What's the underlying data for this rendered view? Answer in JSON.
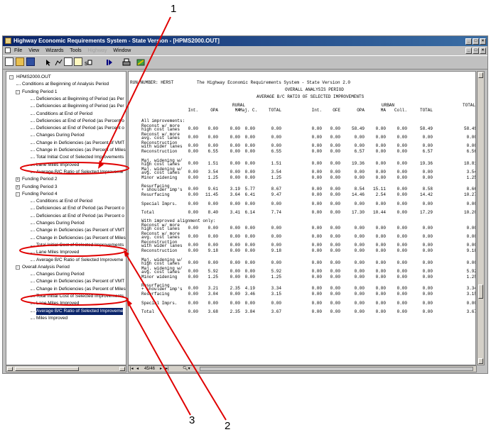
{
  "window": {
    "title": "Highway Economic Requirements System - State Version - [HPMS2000.OUT]",
    "menu": [
      "File",
      "View",
      "Wizards",
      "Tools",
      "Highway",
      "Window"
    ],
    "page_indicator": "45/46"
  },
  "tree": {
    "root": "HPMS2000.OUT",
    "items": [
      {
        "label": "Conditions at Beginning of Analysis Period",
        "level": 1,
        "pm": ""
      },
      {
        "label": "Funding Period 1",
        "level": 1,
        "pm": "-"
      },
      {
        "label": "Deficiencies at Beginning of Period (as Per",
        "level": 2,
        "pm": ""
      },
      {
        "label": "Deficiencies at Beginning of Period (as Per",
        "level": 2,
        "pm": ""
      },
      {
        "label": "Conditions at End of Period",
        "level": 2,
        "pm": ""
      },
      {
        "label": "Deficiencies at End of Period (as Percent o",
        "level": 2,
        "pm": ""
      },
      {
        "label": "Deficiencies at End of Period (as Percent o",
        "level": 2,
        "pm": ""
      },
      {
        "label": "Changes During Period",
        "level": 2,
        "pm": ""
      },
      {
        "label": "Change in Deficiencies (as Percent of VMT",
        "level": 2,
        "pm": ""
      },
      {
        "label": "Change in Deficiencies (as Percent of Miles",
        "level": 2,
        "pm": ""
      },
      {
        "label": "Total Initial Cost of Selected Improvements",
        "level": 2,
        "pm": ""
      },
      {
        "label": "Lane Miles Improved",
        "level": 2,
        "pm": ""
      },
      {
        "label": "Average B/C Ratio of Selected Improveme",
        "level": 2,
        "pm": ""
      },
      {
        "label": "Funding Period 2",
        "level": 1,
        "pm": "+"
      },
      {
        "label": "Funding Period 3",
        "level": 1,
        "pm": "+"
      },
      {
        "label": "Funding Period 4",
        "level": 1,
        "pm": "-"
      },
      {
        "label": "Conditions at End of Period",
        "level": 2,
        "pm": ""
      },
      {
        "label": "Deficiencies at End of Period (as Percent o",
        "level": 2,
        "pm": ""
      },
      {
        "label": "Deficiencies at End of Period (as Percent o",
        "level": 2,
        "pm": ""
      },
      {
        "label": "Changes During Period",
        "level": 2,
        "pm": ""
      },
      {
        "label": "Change in Deficiencies (as Percent of VMT",
        "level": 2,
        "pm": ""
      },
      {
        "label": "Change in Deficiencies (as Percent of Miles",
        "level": 2,
        "pm": ""
      },
      {
        "label": "Total Initial Cost of Selected Improvements",
        "level": 2,
        "pm": ""
      },
      {
        "label": "Lane Miles Improved",
        "level": 2,
        "pm": ""
      },
      {
        "label": "Average B/C Ratio of Selected Improveme",
        "level": 2,
        "pm": ""
      },
      {
        "label": "Overall Analysis Period",
        "level": 1,
        "pm": "-"
      },
      {
        "label": "Changes During Period",
        "level": 2,
        "pm": ""
      },
      {
        "label": "Change in Deficiencies (as Percent of VMT",
        "level": 2,
        "pm": ""
      },
      {
        "label": "Change in Deficiencies (as Percent of Miles",
        "level": 2,
        "pm": ""
      },
      {
        "label": "Total Initial Cost of Selected Improvements",
        "level": 2,
        "pm": ""
      },
      {
        "label": "Lane Miles Improved",
        "level": 2,
        "pm": ""
      },
      {
        "label": "Average B/C Ratio of Selected Improveme",
        "level": 2,
        "pm": "",
        "selected": true
      },
      {
        "label": "Miles Improved",
        "level": 2,
        "pm": ""
      }
    ]
  },
  "report": {
    "run_label": "RUN NUMBER: HERST",
    "system_title": "The Highway Economic Requirements System - State Version 2.0",
    "period_title": "OVERALL ANALYSIS PERIOD",
    "table_title": "AVERAGE B/C RATIO OF SELECTED IMPROVEMENTS",
    "rural_label": "RURAL",
    "urban_label": "URBAN",
    "total_label": "TOTAL",
    "col_headers": [
      "Int.",
      "OPA",
      "MA",
      "Maj. C.",
      "TOTAL",
      "Int.",
      "OFE",
      "OPA",
      "MA",
      "Coll.",
      "TOTAL"
    ],
    "section1": "All improvements:",
    "section2": "With improved alignment only:",
    "rows1": [
      {
        "label1": "Reconst w/ more",
        "label2": "high cost lanes",
        "vals": [
          "0.00",
          "0.00",
          "0.00",
          "0.00",
          "0.00",
          "0.00",
          "0.00",
          "58.49",
          "0.00",
          "0.00",
          "58.49",
          "58.49"
        ]
      },
      {
        "label1": "Reconst w/ more",
        "label2": "avg. cost lanes",
        "vals": [
          "0.00",
          "0.00",
          "0.00",
          "0.00",
          "0.00",
          "0.00",
          "0.00",
          "0.00",
          "0.00",
          "0.00",
          "0.00",
          "0.00"
        ]
      },
      {
        "label1": "Reconstruction",
        "label2": "with wider lanes",
        "vals": [
          "0.00",
          "0.00",
          "0.00",
          "0.00",
          "0.00",
          "0.00",
          "0.00",
          "0.00",
          "0.00",
          "0.00",
          "0.00",
          "0.00"
        ]
      },
      {
        "label1": "Reconstruction",
        "label2": "",
        "vals": [
          "0.00",
          "6.55",
          "0.00",
          "0.00",
          "6.55",
          "0.00",
          "0.00",
          "6.57",
          "0.00",
          "0.00",
          "6.57",
          "6.56"
        ]
      },
      {
        "label1": "Maj. widening w/",
        "label2": "high cost lanes",
        "vals": [
          "0.00",
          "1.51",
          "0.00",
          "0.00",
          "1.51",
          "0.00",
          "0.00",
          "19.36",
          "0.00",
          "0.00",
          "19.36",
          "18.81"
        ]
      },
      {
        "label1": "Maj. widening w/",
        "label2": "avg. cost lanes",
        "vals": [
          "0.00",
          "3.54",
          "0.00",
          "0.00",
          "3.54",
          "0.00",
          "0.00",
          "0.00",
          "0.00",
          "0.00",
          "0.00",
          "3.54"
        ]
      },
      {
        "label1": "Minor widening",
        "label2": "",
        "vals": [
          "0.00",
          "1.25",
          "0.00",
          "0.00",
          "1.25",
          "0.00",
          "0.00",
          "0.00",
          "0.00",
          "0.00",
          "0.00",
          "1.25"
        ]
      },
      {
        "label1": "Resurfacing",
        "label2": "+ shoulder imp's",
        "vals": [
          "0.00",
          "9.61",
          "3.19",
          "5.77",
          "8.67",
          "0.00",
          "0.00",
          "8.54",
          "15.11",
          "0.00",
          "8.58",
          "8.66"
        ]
      },
      {
        "label1": "Resurfacing",
        "label2": "",
        "vals": [
          "0.00",
          "11.45",
          "3.64",
          "6.41",
          "9.47",
          "0.00",
          "0.00",
          "14.46",
          "2.54",
          "0.00",
          "14.42",
          "10.27"
        ]
      },
      {
        "label1": "Special Imprs.",
        "label2": "",
        "vals": [
          "0.00",
          "0.00",
          "0.00",
          "0.00",
          "0.00",
          "0.00",
          "0.00",
          "0.00",
          "0.00",
          "0.00",
          "0.00",
          "0.00"
        ]
      },
      {
        "label1": "Total",
        "label2": "",
        "vals": [
          "0.00",
          "8.40",
          "3.41",
          "6.14",
          "7.74",
          "0.00",
          "0.00",
          "17.30",
          "10.44",
          "0.00",
          "17.29",
          "10.20"
        ]
      }
    ],
    "rows2": [
      {
        "label1": "Reconst w/ more",
        "label2": "high cost lanes",
        "vals": [
          "0.00",
          "0.00",
          "0.00",
          "0.00",
          "0.00",
          "0.00",
          "0.00",
          "0.00",
          "0.00",
          "0.00",
          "0.00",
          "0.00"
        ]
      },
      {
        "label1": "Reconst w/ more",
        "label2": "avg. cost lanes",
        "vals": [
          "0.00",
          "0.00",
          "0.00",
          "0.00",
          "0.00",
          "0.00",
          "0.00",
          "0.00",
          "0.00",
          "0.00",
          "0.00",
          "0.00"
        ]
      },
      {
        "label1": "Reconstruction",
        "label2": "with wider lanes",
        "vals": [
          "0.00",
          "0.00",
          "0.00",
          "0.00",
          "0.00",
          "0.00",
          "0.00",
          "0.00",
          "0.00",
          "0.00",
          "0.00",
          "0.00"
        ]
      },
      {
        "label1": "Reconstruction",
        "label2": "",
        "vals": [
          "0.00",
          "9.18",
          "0.00",
          "0.00",
          "9.18",
          "0.00",
          "0.00",
          "0.00",
          "0.00",
          "0.00",
          "0.00",
          "9.18"
        ]
      },
      {
        "label1": "Maj. widening w/",
        "label2": "high cost lanes",
        "vals": [
          "0.00",
          "0.00",
          "0.00",
          "0.00",
          "0.00",
          "0.00",
          "0.00",
          "0.00",
          "0.00",
          "0.00",
          "0.00",
          "0.00"
        ]
      },
      {
        "label1": "Maj. widening w/",
        "label2": "avg. cost lanes",
        "vals": [
          "0.00",
          "5.92",
          "0.00",
          "0.00",
          "5.92",
          "0.00",
          "0.00",
          "0.00",
          "0.00",
          "0.00",
          "0.00",
          "5.92"
        ]
      },
      {
        "label1": "Minor widening",
        "label2": "",
        "vals": [
          "0.00",
          "1.25",
          "0.00",
          "0.00",
          "1.25",
          "0.00",
          "0.00",
          "0.00",
          "0.00",
          "0.00",
          "0.00",
          "1.25"
        ]
      },
      {
        "label1": "Resurfacing",
        "label2": "+ shoulder imp's",
        "vals": [
          "0.00",
          "3.21",
          "2.35",
          "4.19",
          "3.34",
          "0.00",
          "0.00",
          "0.00",
          "0.00",
          "0.00",
          "0.00",
          "3.34"
        ]
      },
      {
        "label1": "Resurfacing",
        "label2": "",
        "vals": [
          "0.00",
          "3.04",
          "0.00",
          "3.46",
          "3.15",
          "0.00",
          "0.00",
          "0.00",
          "0.00",
          "0.00",
          "0.00",
          "3.15"
        ]
      },
      {
        "label1": "Special Imprs.",
        "label2": "",
        "vals": [
          "0.00",
          "0.00",
          "0.00",
          "0.00",
          "0.00",
          "0.00",
          "0.00",
          "0.00",
          "0.00",
          "0.00",
          "0.00",
          "0.00"
        ]
      },
      {
        "label1": "Total",
        "label2": "",
        "vals": [
          "0.00",
          "3.68",
          "2.35",
          "3.84",
          "3.67",
          "0.00",
          "0.00",
          "0.00",
          "0.00",
          "0.00",
          "0.00",
          "3.67"
        ]
      }
    ]
  },
  "callouts": {
    "one": "1",
    "two": "2",
    "three": "3"
  },
  "colors": {
    "title_bar": "#0a246a",
    "selection": "#0a246a",
    "callout_red": "#e00000"
  }
}
